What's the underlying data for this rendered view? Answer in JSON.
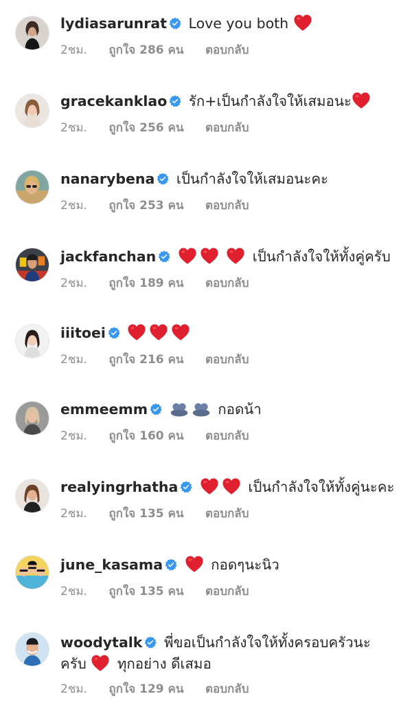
{
  "comments": [
    {
      "username": "lydiasarunrat",
      "text": "Love you both",
      "time": "2ชม.",
      "likes": "ถูกใจ 286 คน",
      "reply": "ตอบกลับ",
      "avatar_icon": "woman-black-outfit-avatar"
    },
    {
      "username": "gracekanklao",
      "text": "รัก+เป็นกำลังใจให้เสมอนะ",
      "time": "2ชม.",
      "likes": "ถูกใจ 256 คน",
      "reply": "ตอบกลับ",
      "avatar_icon": "woman-light-avatar"
    },
    {
      "username": "nanarybena",
      "text": "เป็นกำลังใจให้เสมอนะคะ",
      "time": "2ชม.",
      "likes": "ถูกใจ 253 คน",
      "reply": "ตอบกลับ",
      "avatar_icon": "woman-sunglasses-avatar"
    },
    {
      "username": "jackfanchan",
      "text": "เป็นกำลังใจให้ทั้งคู่ครับ",
      "time": "2ชม.",
      "likes": "ถูกใจ 189 คน",
      "reply": "ตอบกลับ",
      "avatar_icon": "man-colorful-avatar"
    },
    {
      "username": "iiitoei",
      "time": "2ชม.",
      "likes": "ถูกใจ 216 คน",
      "reply": "ตอบกลับ",
      "avatar_icon": "woman-dark-hair-avatar"
    },
    {
      "username": "emmeemm",
      "text": "กอดน้า",
      "time": "2ชม.",
      "likes": "ถูกใจ 160 คน",
      "reply": "ตอบกลับ",
      "avatar_icon": "woman-blonde-avatar"
    },
    {
      "username": "realyingrhatha",
      "text": "เป็นกำลังใจให้ทั้งคู่นะคะ",
      "time": "2ชม.",
      "likes": "ถูกใจ 135 คน",
      "reply": "ตอบกลับ",
      "avatar_icon": "woman-brown-hair-avatar"
    },
    {
      "username": "june_kasama",
      "text": "กอดๆนะนิว",
      "time": "2ชม.",
      "likes": "ถูกใจ 135 คน",
      "reply": "ตอบกลับ",
      "avatar_icon": "cartoon-group-avatar"
    },
    {
      "username": "woodytalk",
      "text_line1": "พี่ขอเป็นกำลังใจให้ทั้งครอบครัวนะ",
      "text_line2_a": "ครับ",
      "text_line2_b": "ทุกอย่าง ดีเสมอ",
      "time": "2ชม.",
      "likes": "ถูกใจ 129 คน",
      "reply": "ตอบกลับ",
      "avatar_icon": "man-smiling-avatar"
    }
  ],
  "colors": {
    "verified": "#3897f0",
    "heart": "#e0202e",
    "meta": "#8e8e8e",
    "text": "#262626"
  }
}
